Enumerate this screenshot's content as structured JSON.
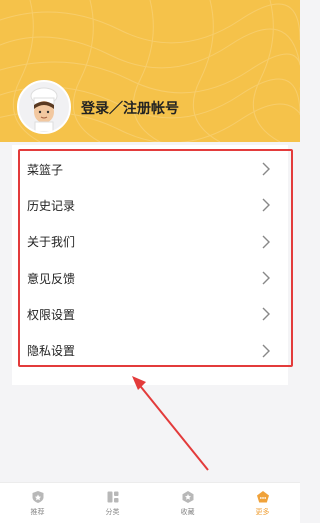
{
  "profile": {
    "login_label": "登录／注册帐号"
  },
  "menu": {
    "items": [
      {
        "label": "菜篮子"
      },
      {
        "label": "历史记录"
      },
      {
        "label": "关于我们"
      },
      {
        "label": "意见反馈"
      },
      {
        "label": "权限设置"
      },
      {
        "label": "隐私设置"
      }
    ]
  },
  "tabbar": {
    "tabs": [
      {
        "label": "推荐",
        "icon": "shield-icon",
        "active": false
      },
      {
        "label": "分类",
        "icon": "category-icon",
        "active": false
      },
      {
        "label": "收藏",
        "icon": "star-icon",
        "active": false
      },
      {
        "label": "更多",
        "icon": "more-icon",
        "active": true
      }
    ]
  },
  "colors": {
    "header": "#f5c24a",
    "highlight": "#e33b3b",
    "active_tab": "#f0a23a",
    "inactive_tab": "#888888"
  }
}
